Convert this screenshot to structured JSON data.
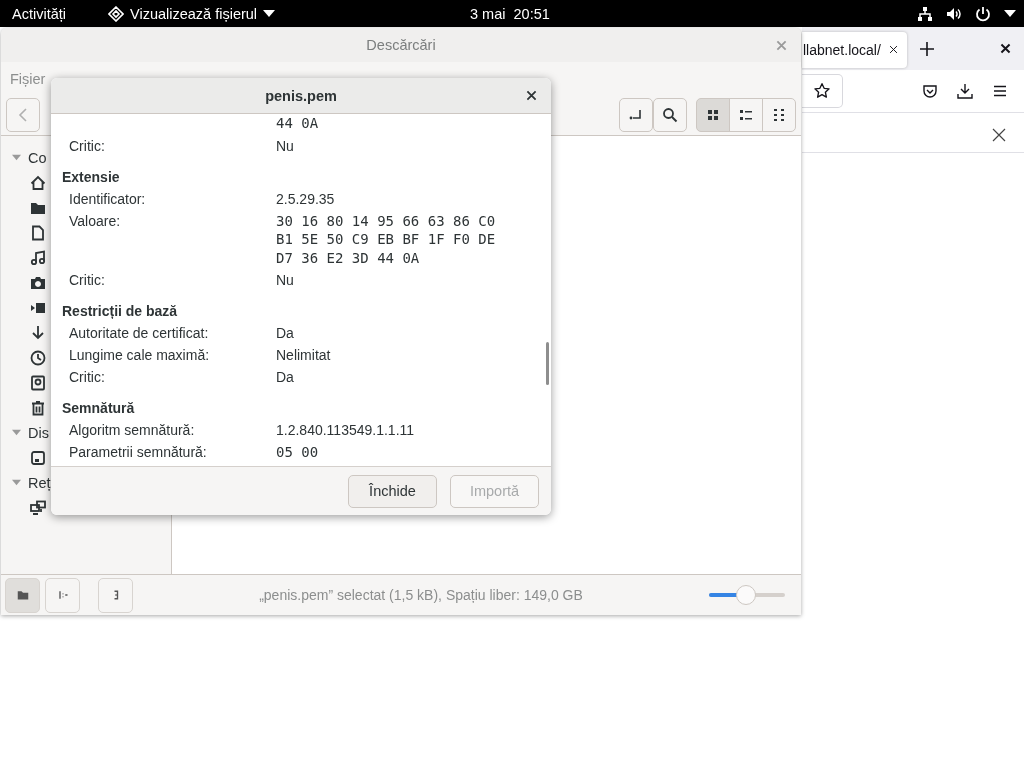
{
  "top_bar": {
    "activities": "Activități",
    "app_menu": "Vizualizează fișierul",
    "clock": "3 mai  20:51"
  },
  "browser": {
    "tab": {
      "title": "llabnet.local/",
      "selected": true
    }
  },
  "file_manager": {
    "title": "Descărcări",
    "menu": [
      "Fișier"
    ],
    "view_buttons": [
      {
        "kind": "grid",
        "selected": true
      },
      {
        "kind": "list",
        "selected": false
      },
      {
        "kind": "compact",
        "selected": false
      }
    ],
    "sidebar": [
      {
        "label": "Co",
        "expanded": true,
        "items": [
          {
            "kind": "home"
          },
          {
            "kind": "folder"
          },
          {
            "kind": "document"
          },
          {
            "kind": "music"
          },
          {
            "kind": "camera"
          },
          {
            "kind": "video"
          },
          {
            "kind": "download"
          },
          {
            "kind": "recent"
          },
          {
            "kind": "frame"
          },
          {
            "kind": "trash"
          }
        ]
      },
      {
        "label": "Dis",
        "expanded": true,
        "items": [
          {
            "kind": "drive"
          }
        ]
      },
      {
        "label": "Reț",
        "expanded": true,
        "items": [
          {
            "kind": "network"
          }
        ]
      }
    ],
    "status_buttons": [
      {
        "kind": "folder",
        "selected": true
      },
      {
        "kind": "numbers",
        "selected": false
      },
      {
        "kind": "bracket",
        "selected": false
      }
    ],
    "status": "„penis.pem” selectat (1,5 kB), Spațiu liber: 149,0 GB",
    "zoom": {
      "level": 0.49
    }
  },
  "dialog": {
    "title": "penis.pem",
    "rows": [
      {
        "kind": "continuation",
        "lines": [
          "44 0A"
        ]
      },
      {
        "kind": "field",
        "label": "Critic:",
        "value": "Nu"
      },
      {
        "kind": "heading",
        "text": "Extensie"
      },
      {
        "kind": "field",
        "label": "Identificator:",
        "value": "2.5.29.35"
      },
      {
        "kind": "hex",
        "label": "Valoare:",
        "lines": [
          "30 16 80 14 95 66 63 86 C0",
          "B1 5E 50 C9 EB BF 1F F0 DE",
          "D7 36 E2 3D 44 0A"
        ]
      },
      {
        "kind": "field",
        "label": "Critic:",
        "value": "Nu"
      },
      {
        "kind": "heading",
        "text": "Restricții de bază"
      },
      {
        "kind": "field",
        "label": "Autoritate de certificat:",
        "value": "Da"
      },
      {
        "kind": "field",
        "label": "Lungime cale maximă:",
        "value": "Nelimitat"
      },
      {
        "kind": "field",
        "label": "Critic:",
        "value": "Da"
      },
      {
        "kind": "heading",
        "text": "Semnătură"
      },
      {
        "kind": "field",
        "label": "Algoritm semnătură:",
        "value": "1.2.840.113549.1.1.11"
      },
      {
        "kind": "hex",
        "label": "Parametrii semnătură:",
        "lines": [
          "05 00"
        ]
      }
    ],
    "buttons": [
      {
        "label": "Închide",
        "disabled": false
      },
      {
        "label": "Importă",
        "disabled": true
      }
    ]
  }
}
